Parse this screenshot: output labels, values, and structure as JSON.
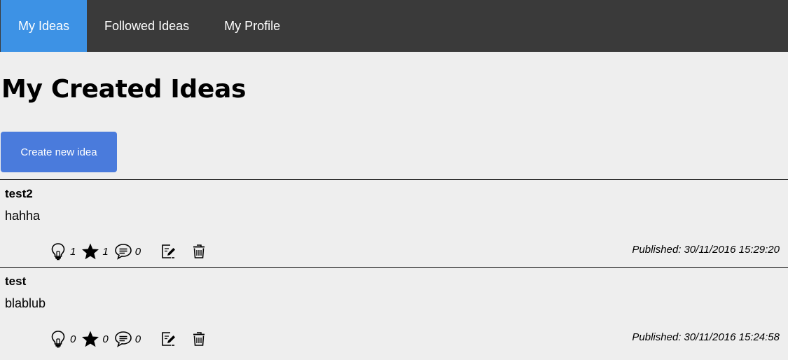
{
  "nav": {
    "items": [
      {
        "label": "My Ideas",
        "active": true
      },
      {
        "label": "Followed Ideas",
        "active": false
      },
      {
        "label": "My Profile",
        "active": false
      }
    ]
  },
  "page": {
    "title": "My Created Ideas",
    "create_button_label": "Create new idea"
  },
  "ideas": [
    {
      "title": "test2",
      "body": "hahha",
      "likes": "1",
      "stars": "1",
      "comments": "0",
      "published_label": "Published:",
      "published_date": "30/11/2016 15:29:20"
    },
    {
      "title": "test",
      "body": "blablub",
      "likes": "0",
      "stars": "0",
      "comments": "0",
      "published_label": "Published:",
      "published_date": "30/11/2016 15:24:58"
    }
  ],
  "icons": {
    "like": "lightbulb-icon",
    "star": "star-icon",
    "comment": "comment-icon",
    "edit": "edit-icon",
    "delete": "trash-icon"
  },
  "colors": {
    "navbar": "#3a3a3a",
    "nav_active": "#3d92e5",
    "create_button": "#4a7bdc",
    "background": "#eeeeee"
  }
}
